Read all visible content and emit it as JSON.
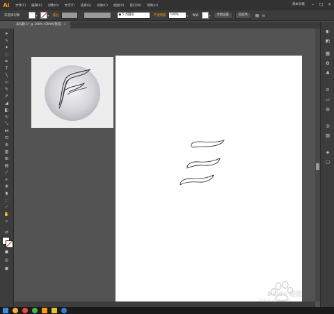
{
  "app": {
    "logo": "Ai",
    "menu": [
      "文件(F)",
      "编辑(E)",
      "对象(O)",
      "文字(T)",
      "选择(S)",
      "效果(C)",
      "视图(V)",
      "窗口(W)",
      "帮助(H)"
    ],
    "workspace": "基本功能",
    "win_min": "–",
    "win_max": "□",
    "win_close": "×"
  },
  "control_bar": {
    "selection_label": "未选择对象",
    "stroke_label": "描边",
    "brush_value": "5 点圆形",
    "opacity_label": "不透明度",
    "opacity_value": "100%",
    "style_label": "样式",
    "doc_setup_button": "文档设置",
    "preferences_button": "首选项"
  },
  "document_tab": {
    "label": "未标题-1* @ 100% (CMYK/预览)",
    "close": "×"
  },
  "watermark": {
    "text": "Baidu 经验",
    "subtext": "jingyan.baidu.com"
  },
  "colors": {
    "accent": "#ff9a00",
    "background": "#535353",
    "panel": "#3c3c3c"
  }
}
